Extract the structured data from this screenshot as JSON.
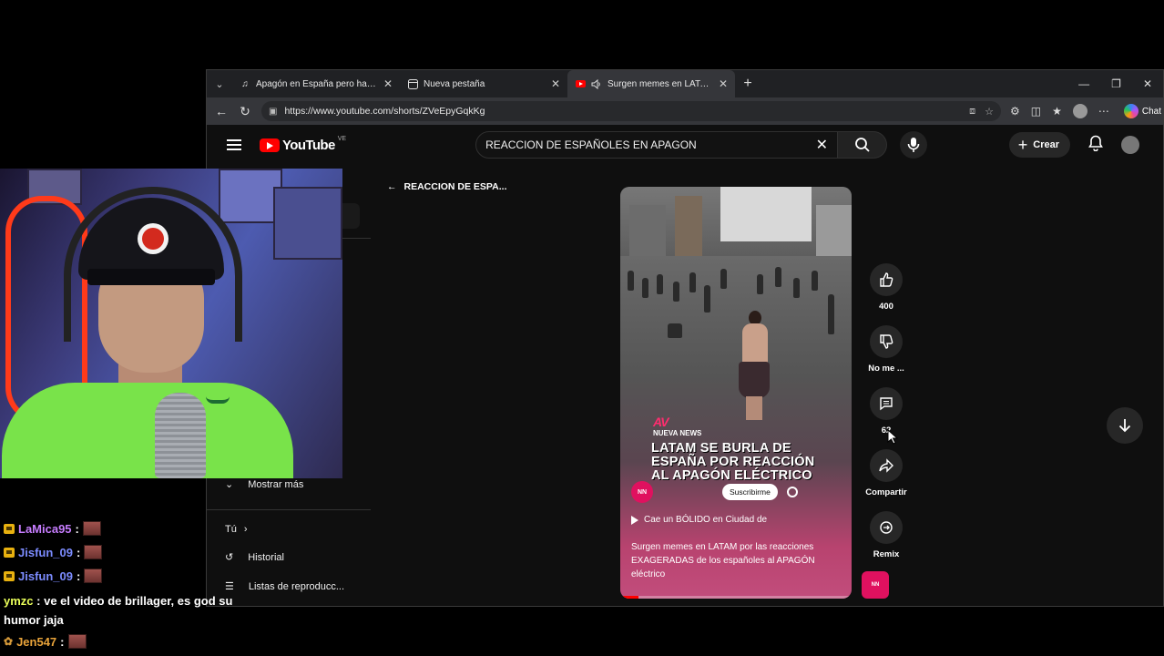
{
  "browser": {
    "tabs": [
      {
        "title": "Apagón en España pero hay gente",
        "icon": "tiktok-icon",
        "active": false
      },
      {
        "title": "Nueva pestaña",
        "icon": "new-tab-page-icon",
        "active": false
      },
      {
        "title": "Surgen memes en LATAM por",
        "icon": "youtube-icon",
        "active": true,
        "muted_icon": "speaker-icon"
      }
    ],
    "url": "https://www.youtube.com/shorts/ZVeEpyGqkKg",
    "chat_label": "Chat"
  },
  "youtube": {
    "search_query": "REACCION DE ESPAÑOLES EN APAGON",
    "logo_text": "YouTube",
    "logo_country": "VE",
    "create_label": "Crear",
    "back_label": "REACCION DE ESPA...",
    "guide": {
      "show_more": "Mostrar más",
      "you": "Tú",
      "history": "Historial",
      "playlists": "Listas de reproducc..."
    },
    "short": {
      "brand": "AV",
      "brand_sub": "NUEVA NEWS",
      "headline": "LATAM SE BURLA DE ESPAÑA POR REACCIÓN AL APAGÓN ELÉCTRICO",
      "subscribe_label": "Suscribirme",
      "related_label": "Cae un BÓLIDO en Ciudad de",
      "description": "Surgen memes en LATAM por las reacciones EXAGERADAS de los españoles al APAGÓN eléctrico",
      "progress_fraction": 0.08
    },
    "actions": {
      "likes": "400",
      "dislike_label": "No me ...",
      "comments": "62",
      "share_label": "Compartir",
      "remix_label": "Remix"
    },
    "accent_color": "#ff0000"
  },
  "stream_chat": [
    {
      "user": "LaMica95",
      "color": "#c77dff",
      "badge": "crown-badge",
      "message": ""
    },
    {
      "user": "Jisfun_09",
      "color": "#7c8cff",
      "badge": "crown-badge",
      "message": ""
    },
    {
      "user": "Jisfun_09",
      "color": "#7c8cff",
      "badge": "crown-badge",
      "message": ""
    },
    {
      "user": "ymzc",
      "color": "#eaff5a",
      "badge": "",
      "message": "ve el video de brillager, es god su humor jaja"
    },
    {
      "user": "Jen547",
      "color": "#e8a33a",
      "badge": "hand-badge",
      "message": ""
    }
  ]
}
